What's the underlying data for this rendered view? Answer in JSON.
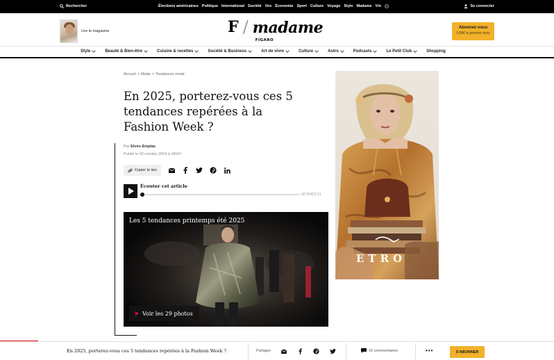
{
  "topbar": {
    "search_label": "Rechercher",
    "nav": [
      "Élections américaines",
      "Politique",
      "International",
      "Société",
      "Vox",
      "Économie",
      "Sport",
      "Culture",
      "Voyage",
      "Style",
      "Madame",
      "Vin"
    ],
    "login_label": "Se connecter"
  },
  "header": {
    "magazine_label": "Lire le magazine",
    "logo_mark": "F",
    "logo_word": "madame",
    "logo_sub": "FIGARO",
    "subscribe_title": "Abonnez-vous",
    "subscribe_sub": "0,99€ le premier mois"
  },
  "catnav": {
    "items": [
      {
        "label": "Style",
        "dropdown": true
      },
      {
        "label": "Beauté & Bien-être",
        "dropdown": true
      },
      {
        "label": "Cuisine & recettes",
        "dropdown": true
      },
      {
        "label": "Société & Business",
        "dropdown": true
      },
      {
        "label": "Art de vivre",
        "dropdown": true
      },
      {
        "label": "Culture",
        "dropdown": true
      },
      {
        "label": "Astro",
        "dropdown": true
      },
      {
        "label": "Podcasts",
        "dropdown": true
      },
      {
        "label": "Le Petit Club",
        "dropdown": true
      },
      {
        "label": "Shopping",
        "dropdown": false
      }
    ]
  },
  "article": {
    "breadcrumb": [
      "Accueil",
      "Mode",
      "Tendances mode"
    ],
    "breadcrumb_sep": ">",
    "title": "En 2025, porterez-vous ces 5 tendances repérées à la Fashion Week ?",
    "byline_prefix": "Par",
    "author": "Elvire Emptaz",
    "published": "Publié le 03 octobre 2024 à 18h57",
    "copy_link": "Copier le lien",
    "audio_label": "Écouter cet article",
    "audio_time": "00:00/02:11",
    "audio_progress": 0,
    "gallery_title": "Les 5 tendances printemps été 2025",
    "gallery_button": "Voir les 29 photos"
  },
  "ad": {
    "brand": "ETRO"
  },
  "sticky": {
    "title": "En 2025, porterez-vous ces 5 tendances repérées à la Fashion Week ?",
    "share_label": "Partager",
    "comments": "16 commentaires",
    "more": "•••",
    "subscribe": "S'ABONNER"
  },
  "colors": {
    "accent": "#f1b12a",
    "topbar": "#000000",
    "progress_red": "#e3101a"
  }
}
